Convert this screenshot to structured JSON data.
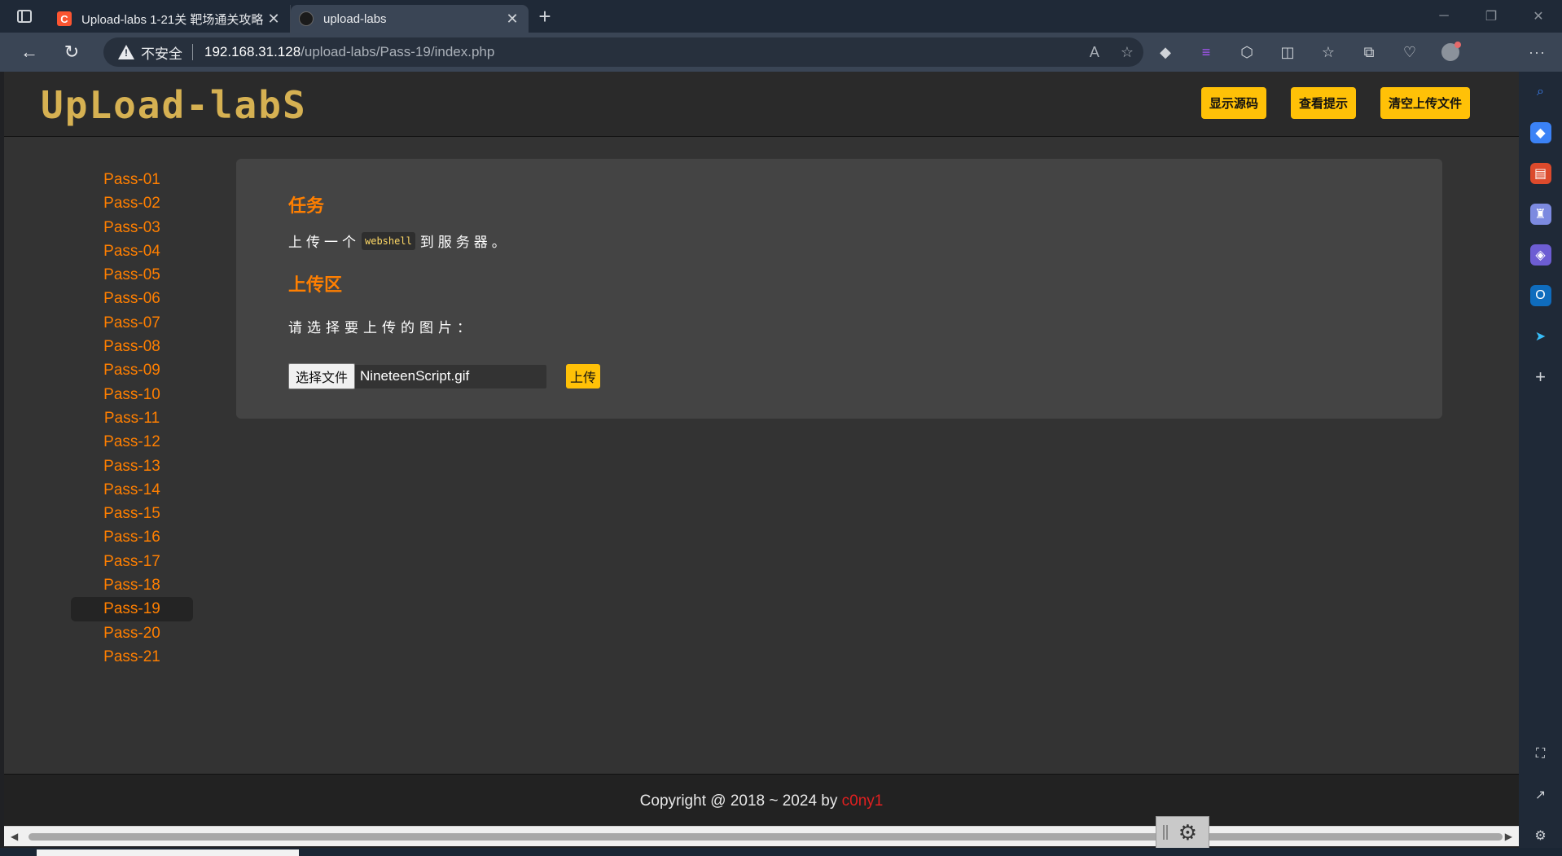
{
  "browser": {
    "tabs": [
      {
        "title": "Upload-labs 1-21关 靶场通关攻略",
        "active": false
      },
      {
        "title": "upload-labs",
        "active": true
      }
    ],
    "address": {
      "insecure_label": "不安全",
      "host": "192.168.31.128",
      "path": "/upload-labs/Pass-19/index.php"
    }
  },
  "header": {
    "logo": "UpLoad-labS",
    "buttons": [
      "显示源码",
      "查看提示",
      "清空上传文件"
    ]
  },
  "menu": {
    "items": [
      "Pass-01",
      "Pass-02",
      "Pass-03",
      "Pass-04",
      "Pass-05",
      "Pass-06",
      "Pass-07",
      "Pass-08",
      "Pass-09",
      "Pass-10",
      "Pass-11",
      "Pass-12",
      "Pass-13",
      "Pass-14",
      "Pass-15",
      "Pass-16",
      "Pass-17",
      "Pass-18",
      "Pass-19",
      "Pass-20",
      "Pass-21"
    ],
    "active": "Pass-19"
  },
  "task": {
    "title": "任务",
    "text_before": "上传一个",
    "code": "webshell",
    "text_after": "到服务器。"
  },
  "upload": {
    "title": "上传区",
    "prompt": "请选择要上传的图片：",
    "choose_button": "选择文件",
    "file_name": "NineteenScript.gif",
    "submit_button": "上传"
  },
  "footer": {
    "text": "Copyright @ 2018 ~ 2024 by ",
    "author": "c0ny1"
  },
  "colors": {
    "accent_orange": "#ff7f00",
    "button_yellow": "#ffc107",
    "author_red": "#e02020"
  }
}
